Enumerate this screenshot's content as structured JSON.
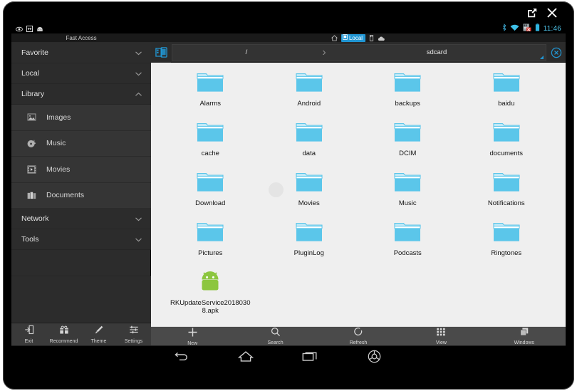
{
  "window": {
    "popout_icon": "open-in-new-icon",
    "close_icon": "close-icon"
  },
  "statusbar": {
    "left_icons": [
      "eye-icon",
      "screenshot-icon",
      "android-head-icon"
    ],
    "right_icons": [
      "bluetooth-icon",
      "wifi-icon",
      "sdcard-error-icon",
      "battery-icon"
    ],
    "time": "11:46"
  },
  "appstrip": {
    "fast_access_label": "Fast Access",
    "home_icon": "home-icon",
    "local_tab_label": "Local",
    "local_tab_icon": "device-icon",
    "storage_icon": "sdcard-icon",
    "cloud_icon": "cloud-icon",
    "accent_color": "#2196d3"
  },
  "sidebar": {
    "groups": [
      {
        "label": "Favorite",
        "expanded": false
      },
      {
        "label": "Local",
        "expanded": false
      },
      {
        "label": "Library",
        "expanded": true
      }
    ],
    "library_items": [
      {
        "label": "Images",
        "icon": "image-icon"
      },
      {
        "label": "Music",
        "icon": "music-disc-icon"
      },
      {
        "label": "Movies",
        "icon": "film-icon"
      },
      {
        "label": "Documents",
        "icon": "documents-icon"
      }
    ],
    "groups_tail": [
      {
        "label": "Network",
        "expanded": false
      },
      {
        "label": "Tools",
        "expanded": false
      }
    ],
    "bottom_buttons": [
      {
        "label": "Exit",
        "icon": "exit-icon"
      },
      {
        "label": "Recommend",
        "icon": "gift-icon"
      },
      {
        "label": "Theme",
        "icon": "theme-brush-icon"
      },
      {
        "label": "Settings",
        "icon": "sliders-icon"
      }
    ]
  },
  "pathbar": {
    "device_icon": "window-device-icon",
    "root_label": "/",
    "separator": "›",
    "current_label": "sdcard",
    "close_tab_icon": "close-circle-icon"
  },
  "files": {
    "items": [
      {
        "name": "Alarms",
        "type": "folder"
      },
      {
        "name": "Android",
        "type": "folder"
      },
      {
        "name": "backups",
        "type": "folder"
      },
      {
        "name": "baidu",
        "type": "folder"
      },
      {
        "name": "cache",
        "type": "folder"
      },
      {
        "name": "data",
        "type": "folder"
      },
      {
        "name": "DCIM",
        "type": "folder"
      },
      {
        "name": "documents",
        "type": "folder"
      },
      {
        "name": "Download",
        "type": "folder"
      },
      {
        "name": "Movies",
        "type": "folder",
        "pressed": true
      },
      {
        "name": "Music",
        "type": "folder"
      },
      {
        "name": "Notifications",
        "type": "folder"
      },
      {
        "name": "Pictures",
        "type": "folder"
      },
      {
        "name": "PluginLog",
        "type": "folder"
      },
      {
        "name": "Podcasts",
        "type": "folder"
      },
      {
        "name": "Ringtones",
        "type": "folder"
      },
      {
        "name": "RKUpdateService20180308.apk",
        "type": "apk"
      }
    ],
    "folder_color": "#5bc6ea",
    "folder_tab_color": "#bfe9f7",
    "apk_color": "#8cc63f"
  },
  "content_toolbar": {
    "buttons": [
      {
        "label": "New",
        "icon": "plus-icon"
      },
      {
        "label": "Search",
        "icon": "search-icon"
      },
      {
        "label": "Refresh",
        "icon": "refresh-icon"
      },
      {
        "label": "View",
        "icon": "grid-view-icon"
      },
      {
        "label": "Windows",
        "icon": "windows-stack-icon"
      }
    ]
  },
  "navbar": {
    "buttons": [
      {
        "icon": "back-icon"
      },
      {
        "icon": "home-icon"
      },
      {
        "icon": "recents-icon"
      },
      {
        "icon": "chrome-icon"
      }
    ]
  }
}
